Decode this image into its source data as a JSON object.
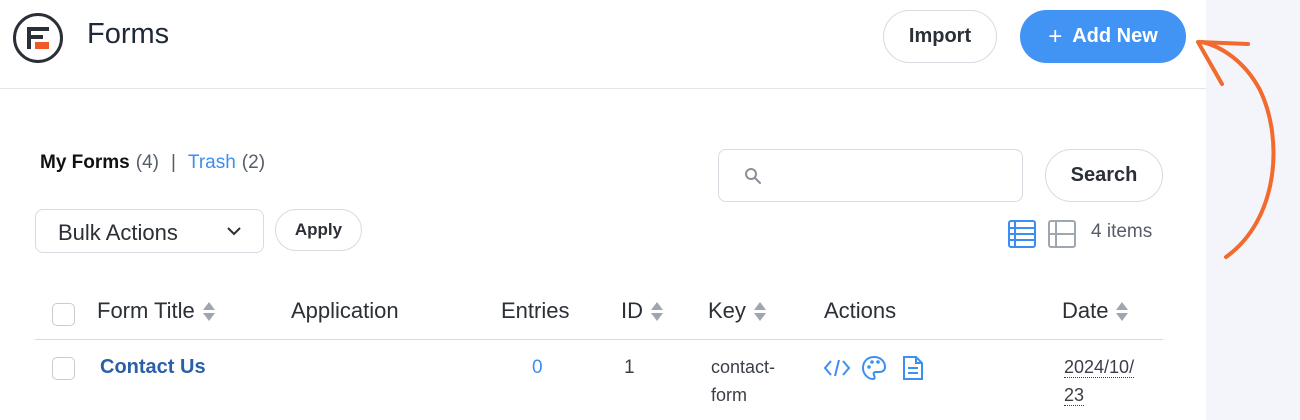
{
  "header": {
    "title": "Forms",
    "import_label": "Import",
    "add_new_label": "Add New",
    "add_new_icon": "plus-icon"
  },
  "colors": {
    "accent": "#4193f4",
    "logo_accent": "#f05a28",
    "arrow": "#f26a2e",
    "link": "#3b8ff0"
  },
  "views": {
    "my_forms_label": "My Forms",
    "my_forms_count": "(4)",
    "separator": "|",
    "trash_label": "Trash",
    "trash_count": "(2)"
  },
  "search": {
    "placeholder": "",
    "button_label": "Search"
  },
  "bulk": {
    "selected": "Bulk Actions",
    "apply_label": "Apply"
  },
  "list": {
    "item_count": "4 items"
  },
  "table": {
    "columns": {
      "title": "Form Title",
      "application": "Application",
      "entries": "Entries",
      "id": "ID",
      "key": "Key",
      "actions": "Actions",
      "date": "Date"
    },
    "rows": [
      {
        "title": "Contact Us",
        "application": "",
        "entries": "0",
        "id": "1",
        "key_line1": "contact-",
        "key_line2": "form",
        "date_line1": "2024/10/",
        "date_line2": "23",
        "action_icons": [
          "code-icon",
          "palette-icon",
          "document-icon"
        ]
      }
    ]
  }
}
